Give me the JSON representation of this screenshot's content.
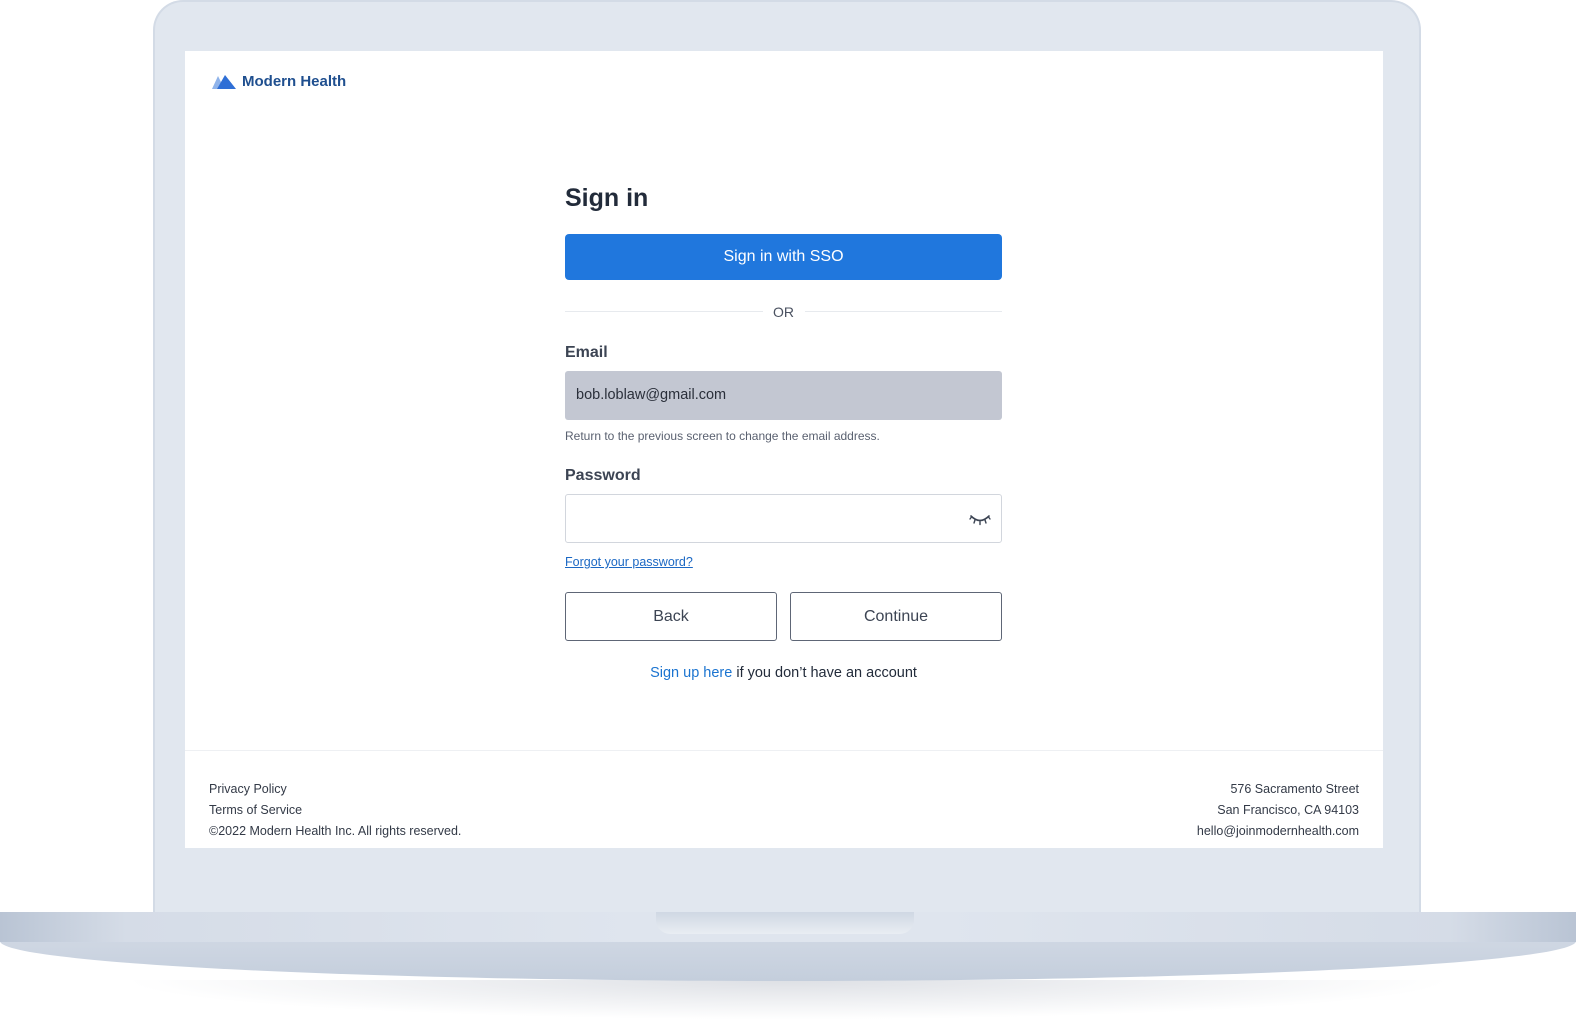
{
  "brand": {
    "name": "Modern Health",
    "logo_icon": "mountain-logo-icon",
    "color": "#1f4f8f"
  },
  "form": {
    "title": "Sign in",
    "sso_button": "Sign in with SSO",
    "divider_text": "OR",
    "email_label": "Email",
    "email_value": "bob.loblaw@gmail.com",
    "email_help": "Return to the previous screen to change the email address.",
    "password_label": "Password",
    "password_value": "",
    "password_toggle_icon": "eye-closed-icon",
    "forgot_link": "Forgot your password?",
    "back_button": "Back",
    "continue_button": "Continue",
    "signup_link": "Sign up here",
    "signup_text": " if you don’t have an account"
  },
  "footer": {
    "links": [
      "Privacy Policy",
      "Terms of Service"
    ],
    "copyright": "©2022 Modern Health Inc. All rights reserved.",
    "address_line1": "576 Sacramento Street",
    "address_line2": "San Francisco, CA 94103",
    "email": "hello@joinmodernhealth.com"
  },
  "colors": {
    "primary": "#2077dd",
    "link": "#1b68c4",
    "disabled_field": "#c3c7d2",
    "device_frame": "#e1e7ef"
  }
}
